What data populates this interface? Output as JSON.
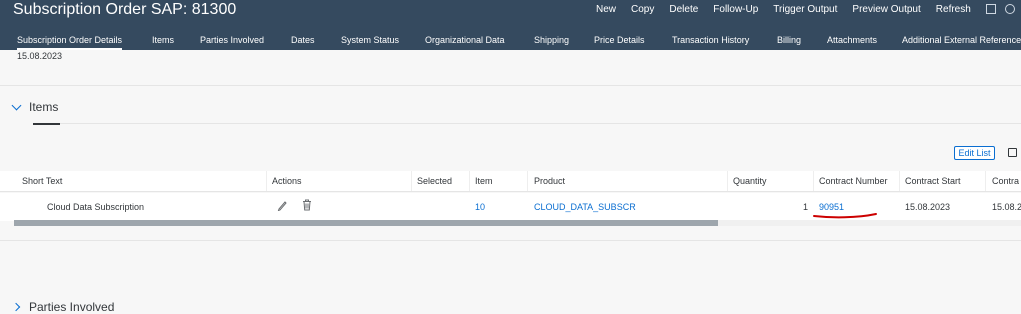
{
  "header": {
    "title": "Subscription Order SAP: 81300",
    "actions": [
      "New",
      "Copy",
      "Delete",
      "Follow-Up",
      "Trigger Output",
      "Preview Output",
      "Refresh"
    ]
  },
  "tabs": [
    "Subscription Order Details",
    "Items",
    "Parties Involved",
    "Dates",
    "System Status",
    "Organizational Data",
    "Shipping",
    "Price Details",
    "Transaction History",
    "Billing",
    "Attachments",
    "Additional External Reference"
  ],
  "content": {
    "date_top": "15.08.2023",
    "items_section": {
      "title": "Items",
      "edit_list_label": "Edit List",
      "columns": {
        "short_text": "Short Text",
        "actions": "Actions",
        "selected": "Selected",
        "item": "Item",
        "product": "Product",
        "quantity": "Quantity",
        "contract_number": "Contract Number",
        "contract_start": "Contract Start",
        "contract_end": "Contra"
      },
      "row": {
        "short_text": "Cloud Data Subscription",
        "item": "10",
        "product": "CLOUD_DATA_SUBSCR",
        "quantity": "1",
        "contract_number": "90951",
        "contract_start": "15.08.2023",
        "contract_end": "15.08.2"
      }
    },
    "next_section_title": "Parties Involved"
  },
  "colors": {
    "shell": "#354a5f",
    "link": "#0a6ed1",
    "annotation": "#cc0000"
  }
}
